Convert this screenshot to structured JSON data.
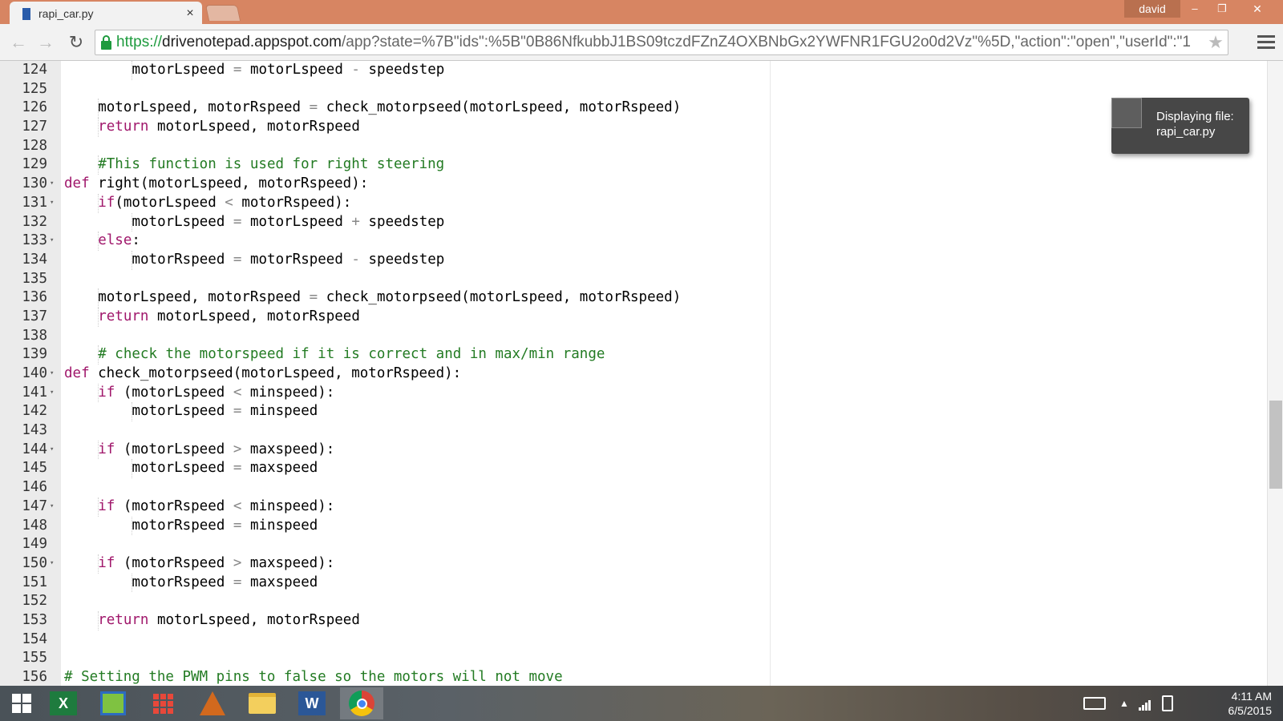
{
  "browser": {
    "tab_title": "rapi_car.py",
    "tab_close": "×",
    "user": "david",
    "window_controls": {
      "minimize": "–",
      "restore": "❐",
      "close": "✕"
    },
    "url_scheme": "https://",
    "url_host": "drivenotepad.appspot.com",
    "url_rest": "/app?state=%7B\"ids\":%5B\"0B86NfkubbJ1BS09tczdFZnZ4OXBNbGx2YWFNR1FGU2o0d2Vz\"%5D,\"action\":\"open\",\"userId\":\"1",
    "icons": {
      "back": "back-arrow-icon",
      "forward": "forward-arrow-icon",
      "reload": "reload-icon",
      "lock": "lock-icon",
      "star": "star-icon",
      "menu": "hamburger-menu-icon"
    }
  },
  "toast": {
    "line1": "Displaying file:",
    "line2": "rapi_car.py"
  },
  "editor": {
    "lines": [
      {
        "n": "124",
        "fold": false,
        "indent": 2,
        "parts": [
          [
            "motorLspeed ",
            "t"
          ],
          [
            "=",
            "o"
          ],
          [
            " motorLspeed ",
            "t"
          ],
          [
            "-",
            "o"
          ],
          [
            " speedstep",
            "t"
          ]
        ]
      },
      {
        "n": "125",
        "fold": false,
        "indent": 0,
        "parts": []
      },
      {
        "n": "126",
        "fold": false,
        "indent": 1,
        "parts": [
          [
            "motorLspeed, motorRspeed ",
            "t"
          ],
          [
            "=",
            "o"
          ],
          [
            " check_motorpseed(motorLspeed, motorRspeed)",
            "t"
          ]
        ]
      },
      {
        "n": "127",
        "fold": false,
        "indent": 1,
        "parts": [
          [
            "return",
            "k"
          ],
          [
            " motorLspeed, motorRspeed",
            "t"
          ]
        ]
      },
      {
        "n": "128",
        "fold": false,
        "indent": 0,
        "parts": []
      },
      {
        "n": "129",
        "fold": false,
        "indent": 1,
        "parts": [
          [
            "#This function is used for right steering",
            "c"
          ]
        ]
      },
      {
        "n": "130",
        "fold": true,
        "indent": 0,
        "parts": [
          [
            "def",
            "k"
          ],
          [
            " right(motorLspeed, motorRspeed):",
            "t"
          ]
        ]
      },
      {
        "n": "131",
        "fold": true,
        "indent": 1,
        "parts": [
          [
            "if",
            "k"
          ],
          [
            "(motorLspeed ",
            "t"
          ],
          [
            "<",
            "o"
          ],
          [
            " motorRspeed):",
            "t"
          ]
        ]
      },
      {
        "n": "132",
        "fold": false,
        "indent": 2,
        "parts": [
          [
            "motorLspeed ",
            "t"
          ],
          [
            "=",
            "o"
          ],
          [
            " motorLspeed ",
            "t"
          ],
          [
            "+",
            "o"
          ],
          [
            " speedstep",
            "t"
          ]
        ]
      },
      {
        "n": "133",
        "fold": true,
        "indent": 1,
        "parts": [
          [
            "else",
            "k"
          ],
          [
            ":",
            "t"
          ]
        ]
      },
      {
        "n": "134",
        "fold": false,
        "indent": 2,
        "parts": [
          [
            "motorRspeed ",
            "t"
          ],
          [
            "=",
            "o"
          ],
          [
            " motorRspeed ",
            "t"
          ],
          [
            "-",
            "o"
          ],
          [
            " speedstep",
            "t"
          ]
        ]
      },
      {
        "n": "135",
        "fold": false,
        "indent": 0,
        "parts": []
      },
      {
        "n": "136",
        "fold": false,
        "indent": 1,
        "parts": [
          [
            "motorLspeed, motorRspeed ",
            "t"
          ],
          [
            "=",
            "o"
          ],
          [
            " check_motorpseed(motorLspeed, motorRspeed)",
            "t"
          ]
        ]
      },
      {
        "n": "137",
        "fold": false,
        "indent": 1,
        "parts": [
          [
            "return",
            "k"
          ],
          [
            " motorLspeed, motorRspeed",
            "t"
          ]
        ]
      },
      {
        "n": "138",
        "fold": false,
        "indent": 0,
        "parts": []
      },
      {
        "n": "139",
        "fold": false,
        "indent": 1,
        "parts": [
          [
            "# check the motorspeed if it is correct and in max/min range",
            "c"
          ]
        ]
      },
      {
        "n": "140",
        "fold": true,
        "indent": 0,
        "parts": [
          [
            "def",
            "k"
          ],
          [
            " check_motorpseed(motorLspeed, motorRspeed):",
            "t"
          ]
        ]
      },
      {
        "n": "141",
        "fold": true,
        "indent": 1,
        "parts": [
          [
            "if",
            "k"
          ],
          [
            " (motorLspeed ",
            "t"
          ],
          [
            "<",
            "o"
          ],
          [
            " minspeed):",
            "t"
          ]
        ]
      },
      {
        "n": "142",
        "fold": false,
        "indent": 2,
        "parts": [
          [
            "motorLspeed ",
            "t"
          ],
          [
            "=",
            "o"
          ],
          [
            " minspeed",
            "t"
          ]
        ]
      },
      {
        "n": "143",
        "fold": false,
        "indent": 0,
        "parts": []
      },
      {
        "n": "144",
        "fold": true,
        "indent": 1,
        "parts": [
          [
            "if",
            "k"
          ],
          [
            " (motorLspeed ",
            "t"
          ],
          [
            ">",
            "o"
          ],
          [
            " maxspeed):",
            "t"
          ]
        ]
      },
      {
        "n": "145",
        "fold": false,
        "indent": 2,
        "parts": [
          [
            "motorLspeed ",
            "t"
          ],
          [
            "=",
            "o"
          ],
          [
            " maxspeed",
            "t"
          ]
        ]
      },
      {
        "n": "146",
        "fold": false,
        "indent": 0,
        "parts": []
      },
      {
        "n": "147",
        "fold": true,
        "indent": 1,
        "parts": [
          [
            "if",
            "k"
          ],
          [
            " (motorRspeed ",
            "t"
          ],
          [
            "<",
            "o"
          ],
          [
            " minspeed):",
            "t"
          ]
        ]
      },
      {
        "n": "148",
        "fold": false,
        "indent": 2,
        "parts": [
          [
            "motorRspeed ",
            "t"
          ],
          [
            "=",
            "o"
          ],
          [
            " minspeed",
            "t"
          ]
        ]
      },
      {
        "n": "149",
        "fold": false,
        "indent": 0,
        "parts": []
      },
      {
        "n": "150",
        "fold": true,
        "indent": 1,
        "parts": [
          [
            "if",
            "k"
          ],
          [
            " (motorRspeed ",
            "t"
          ],
          [
            ">",
            "o"
          ],
          [
            " maxspeed):",
            "t"
          ]
        ]
      },
      {
        "n": "151",
        "fold": false,
        "indent": 2,
        "parts": [
          [
            "motorRspeed ",
            "t"
          ],
          [
            "=",
            "o"
          ],
          [
            " maxspeed",
            "t"
          ]
        ]
      },
      {
        "n": "152",
        "fold": false,
        "indent": 0,
        "parts": []
      },
      {
        "n": "153",
        "fold": false,
        "indent": 1,
        "parts": [
          [
            "return",
            "k"
          ],
          [
            " motorLspeed, motorRspeed",
            "t"
          ]
        ]
      },
      {
        "n": "154",
        "fold": false,
        "indent": 0,
        "parts": []
      },
      {
        "n": "155",
        "fold": false,
        "indent": 0,
        "parts": []
      },
      {
        "n": "156",
        "fold": false,
        "indent": 0,
        "parts": [
          [
            "# Setting the PWM pins to false so the motors will not move",
            "c"
          ]
        ]
      }
    ],
    "colors": {
      "keyword": "#a0176b",
      "comment": "#237b23",
      "operator": "#888888"
    }
  },
  "taskbar": {
    "apps": [
      {
        "name": "start-button",
        "icon": "windows-logo-icon"
      },
      {
        "name": "excel-app",
        "icon": "excel-icon",
        "letter": "X"
      },
      {
        "name": "maps-app",
        "icon": "maps-icon"
      },
      {
        "name": "apps-app",
        "icon": "app-grid-icon"
      },
      {
        "name": "matlab-app",
        "icon": "matlab-icon"
      },
      {
        "name": "file-explorer-app",
        "icon": "folder-icon"
      },
      {
        "name": "word-app",
        "icon": "word-icon",
        "letter": "W"
      },
      {
        "name": "chrome-app",
        "icon": "chrome-icon",
        "active": true
      }
    ],
    "tray_up": "▲",
    "time": "4:11 AM",
    "date": "6/5/2015"
  }
}
